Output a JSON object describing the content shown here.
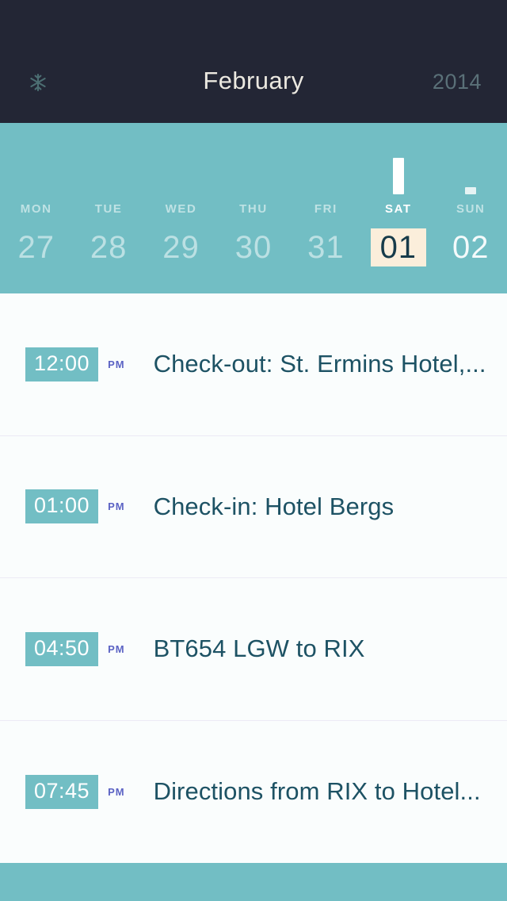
{
  "header": {
    "icon": "snowflake-icon",
    "month": "February",
    "year": "2014"
  },
  "week": {
    "days": [
      {
        "name": "MON",
        "num": "27",
        "state": "dim",
        "marker": "none"
      },
      {
        "name": "TUE",
        "num": "28",
        "state": "dim",
        "marker": "none"
      },
      {
        "name": "WED",
        "num": "29",
        "state": "dim",
        "marker": "none"
      },
      {
        "name": "THU",
        "num": "30",
        "state": "dim",
        "marker": "none"
      },
      {
        "name": "FRI",
        "num": "31",
        "state": "dim",
        "marker": "none"
      },
      {
        "name": "SAT",
        "num": "01",
        "state": "active",
        "marker": "tall"
      },
      {
        "name": "SUN",
        "num": "02",
        "state": "normal",
        "marker": "small"
      }
    ]
  },
  "events": [
    {
      "time": "12:00",
      "meridiem": "PM",
      "title": "Check-out: St. Ermins Hotel,..."
    },
    {
      "time": "01:00",
      "meridiem": "PM",
      "title": "Check-in: Hotel Bergs"
    },
    {
      "time": "04:50",
      "meridiem": "PM",
      "title": "BT654 LGW to RIX"
    },
    {
      "time": "07:45",
      "meridiem": "PM",
      "title": "Directions from RIX to Hotel..."
    }
  ],
  "colors": {
    "header_bg": "#232635",
    "teal": "#72bec4",
    "selected_day_bg": "#fbeedb",
    "selected_day_text": "#173b4a",
    "event_title": "#1d5264",
    "meridiem": "#5b63c4",
    "divider": "#eceaf5",
    "list_bg": "#fafdfd",
    "year_text": "#5a7078",
    "month_text": "#ebe8e0"
  }
}
